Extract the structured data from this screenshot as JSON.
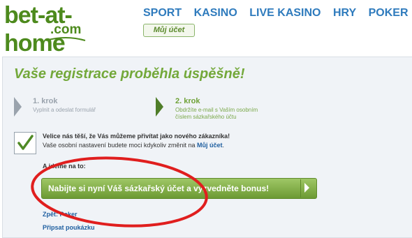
{
  "header": {
    "logo": {
      "main": "bet-at-home",
      "sub": ".com"
    },
    "nav": [
      "SPORT",
      "KASINO",
      "LIVE KASINO",
      "HRY",
      "POKER"
    ],
    "account_button": "Můj účet"
  },
  "main": {
    "title": "Vaše registrace proběhla úspěšně!",
    "steps": [
      {
        "heading": "1. krok",
        "text_line1": "Vyplnit a odeslat formulář",
        "text_line2": ""
      },
      {
        "heading": "2. krok",
        "text_line1": "Obdržíte e-mail s Vaším osobním",
        "text_line2": "číslem sázkařského účtu"
      }
    ],
    "welcome_line1": "Velice nás těší, že Vás můžeme přivítat jako nového zákazníka!",
    "welcome_line2": "Vaše osobní nastavení budete moci kdykoliv změnit na",
    "welcome_link": "Můj účet",
    "welcome_end": ".",
    "and_now": "A jdeme na to:",
    "cta_label": "Nabijte si nyní Váš sázkařský účet a vyzvedněte bonus!",
    "links": [
      "Zpět: Poker",
      "Připsat poukázku"
    ]
  },
  "colors": {
    "brand_green": "#4d8a1d",
    "nav_blue": "#2f7bbd",
    "title_green": "#73a83a",
    "cta_green": "#7fab43",
    "annotation_red": "#e01e1e"
  },
  "icons": {
    "check": "check-icon",
    "step_arrow": "step-arrow-icon",
    "cta_arrow": "play-arrow-icon"
  }
}
